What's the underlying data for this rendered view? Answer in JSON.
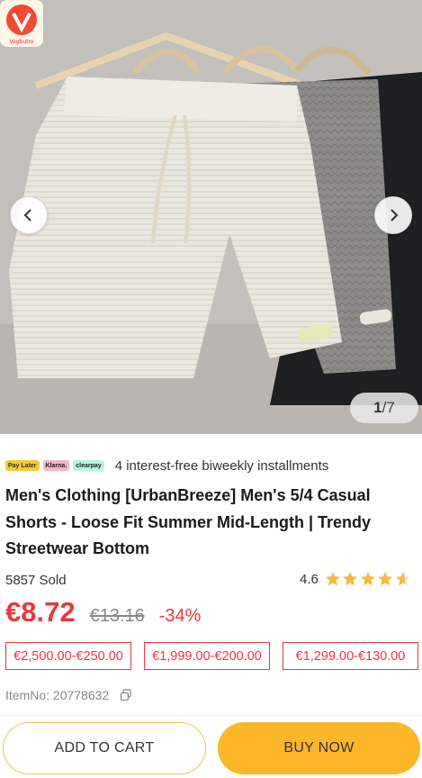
{
  "gallery": {
    "current": "1",
    "separator": "/",
    "total": "7",
    "brand_badge_text": "Vegbutro"
  },
  "payment": {
    "badges": [
      "Pay Later",
      "Klarna.",
      "clearpay"
    ],
    "installments_text": "4 interest-free biweekly installments"
  },
  "product": {
    "title": "Men's Clothing [UrbanBreeze] Men's 5/4 Casual Shorts - Loose Fit Summer Mid-Length | Trendy Streetwear Bottom",
    "sold_text": "5857 Sold",
    "rating": "4.6",
    "rating_value": 4.6,
    "price": "€8.72",
    "original_price": "€13.16",
    "discount": "-34%",
    "tier_prices": [
      "€2,500.00-€250.00",
      "€1,999.00-€200.00",
      "€1,299.00-€130.00"
    ],
    "item_no": "ItemNo: 20778632"
  },
  "actions": {
    "add_to_cart": "ADD TO CART",
    "buy_now": "BUY NOW"
  },
  "colors": {
    "accent_red": "#e8383d",
    "button_yellow": "#fbb62a",
    "star": "#f6b93b"
  }
}
